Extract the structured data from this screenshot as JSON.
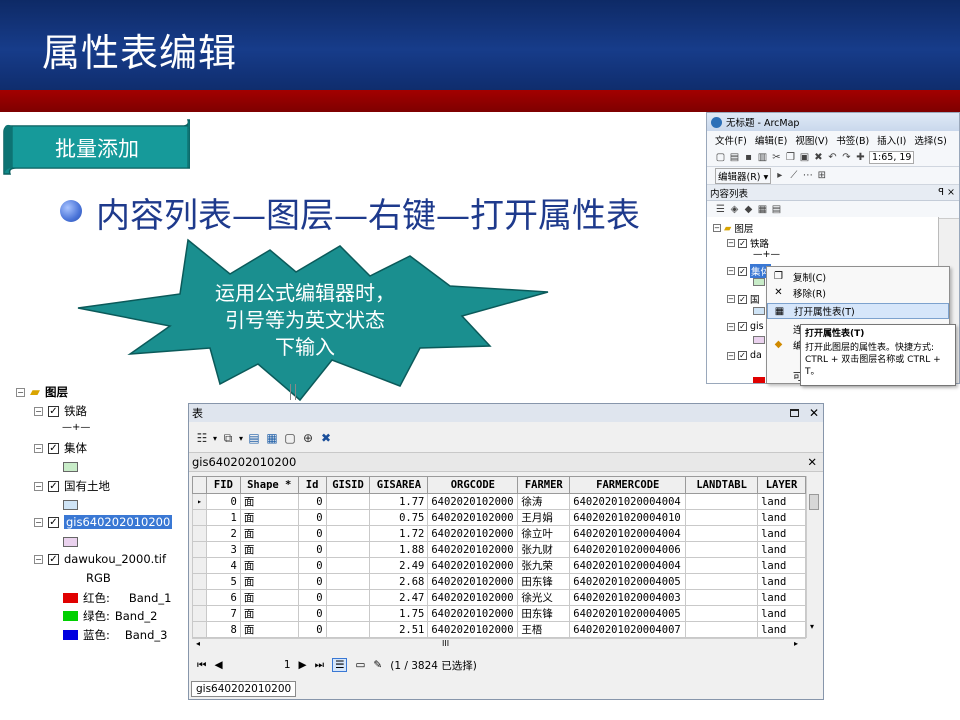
{
  "slide": {
    "title": "属性表编辑",
    "banner_label": "批量添加",
    "bullet": "内容列表—图层—右键—打开属性表",
    "callout_lines": [
      "运用公式编辑器时，",
      "引号等为英文状态",
      "下输入"
    ]
  },
  "arcmap": {
    "title": "无标题 - ArcMap",
    "menu": [
      "文件(F)",
      "编辑(E)",
      "视图(V)",
      "书签(B)",
      "插入(I)",
      "选择(S)"
    ],
    "scale": "1:65, 19",
    "editor_label": "编辑器(R) ▾",
    "toc_title": "内容列表",
    "toc_ctrls": "ꟼ ×",
    "layers_root": "图层",
    "layer_rail": "铁路",
    "layer_jiti_trunc": "集体",
    "layer_guo_trunc": "国",
    "layer_gis_trunc": "gis",
    "layer_da_trunc": "da",
    "context_menu": [
      {
        "label": "复制(C)",
        "icon": "copy-icon"
      },
      {
        "label": "移除(R)",
        "icon": "remove-icon"
      },
      {
        "label": "打开属性表(T)",
        "icon": "table-icon"
      },
      {
        "label": "连",
        "icon": ""
      },
      {
        "label": "编",
        "icon": "edit-icon"
      },
      {
        "label": "",
        "icon": ""
      },
      {
        "label": "可",
        "icon": ""
      }
    ],
    "tooltip_title": "打开属性表(T)",
    "tooltip_body": "打开此图层的属性表。快捷方式: CTRL + 双击图层名称或 CTRL + T。"
  },
  "toc": {
    "root": "图层",
    "layers": [
      {
        "name": "铁路",
        "symbol": "—+—"
      },
      {
        "name": "集体",
        "swatch": "#c8ecc8"
      },
      {
        "name": "国有土地",
        "swatch": "#cfe4f6"
      },
      {
        "name": "gis640202010200",
        "swatch": "#ead2ee",
        "selected": true
      },
      {
        "name": "dawukou_2000.tif"
      }
    ],
    "rgb_label": "RGB",
    "bands": [
      {
        "label": "红色:",
        "band": "Band_1",
        "color": "#e00000"
      },
      {
        "label": "绿色:",
        "band": "Band_2",
        "color": "#00d000"
      },
      {
        "label": "蓝色:",
        "band": "Band_3",
        "color": "#0000e0"
      }
    ]
  },
  "table_window": {
    "title": "表",
    "tab_name": "gis640202010200",
    "columns": [
      "FID",
      "Shape *",
      "Id",
      "GISID",
      "GISAREA",
      "ORGCODE",
      "FARMER",
      "FARMERCODE",
      "LANDTABL",
      "LAYER"
    ],
    "rows": [
      [
        "0",
        "面",
        "0",
        "",
        "1.77",
        "6402020102000",
        "徐涛",
        "64020201020004004",
        "",
        "land"
      ],
      [
        "1",
        "面",
        "0",
        "",
        "0.75",
        "6402020102000",
        "王月娟",
        "64020201020004010",
        "",
        "land"
      ],
      [
        "2",
        "面",
        "0",
        "",
        "1.72",
        "6402020102000",
        "徐立叶",
        "64020201020004004",
        "",
        "land"
      ],
      [
        "3",
        "面",
        "0",
        "",
        "1.88",
        "6402020102000",
        "张九财",
        "64020201020004006",
        "",
        "land"
      ],
      [
        "4",
        "面",
        "0",
        "",
        "2.49",
        "6402020102000",
        "张九荣",
        "64020201020004004",
        "",
        "land"
      ],
      [
        "5",
        "面",
        "0",
        "",
        "2.68",
        "6402020102000",
        "田东锋",
        "64020201020004005",
        "",
        "land"
      ],
      [
        "6",
        "面",
        "0",
        "",
        "2.47",
        "6402020102000",
        "徐光义",
        "64020201020004003",
        "",
        "land"
      ],
      [
        "7",
        "面",
        "0",
        "",
        "1.75",
        "6402020102000",
        "田东锋",
        "64020201020004005",
        "",
        "land"
      ],
      [
        "8",
        "面",
        "0",
        "",
        "2.51",
        "6402020102000",
        "王梧",
        "64020201020004007",
        "",
        "land"
      ]
    ],
    "scroll_marker": "III",
    "record_current": "1",
    "selection_status": "(1 / 3824 已选择)",
    "status_tab": "gis640202010200"
  }
}
